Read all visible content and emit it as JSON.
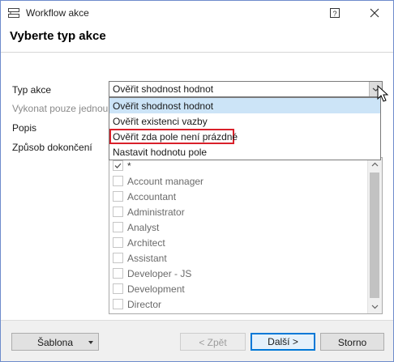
{
  "window": {
    "title": "Workflow akce"
  },
  "heading": "Vyberte typ akce",
  "form": {
    "type_label": "Typ akce",
    "run_once_label": "Vykonat pouze jednou",
    "description_label": "Popis",
    "completion_label": "Způsob dokončení",
    "type_value": "Ověřit shodnost hodnot"
  },
  "dropdown": {
    "options": [
      "Ověřit shodnost hodnot",
      "Ověřit existenci vazby",
      "Ověřit zda pole není prázdné",
      "Nastavit hodnotu pole"
    ],
    "selected_index": 0,
    "highlighted_index": 2
  },
  "roles_list": {
    "items": [
      {
        "label": "*",
        "checked": true
      },
      {
        "label": "Account manager",
        "checked": false
      },
      {
        "label": "Accountant",
        "checked": false
      },
      {
        "label": "Administrator",
        "checked": false
      },
      {
        "label": "Analyst",
        "checked": false
      },
      {
        "label": "Architect",
        "checked": false
      },
      {
        "label": "Assistant",
        "checked": false
      },
      {
        "label": "Developer - JS",
        "checked": false
      },
      {
        "label": "Development",
        "checked": false
      },
      {
        "label": "Director",
        "checked": false
      }
    ]
  },
  "footer": {
    "template_label": "Šablona",
    "back_label": "< Zpět",
    "next_label": "Další >",
    "cancel_label": "Storno"
  },
  "colors": {
    "selection": "#cce4f7",
    "highlight_border": "#d9202a",
    "primary_border": "#0078d7"
  }
}
